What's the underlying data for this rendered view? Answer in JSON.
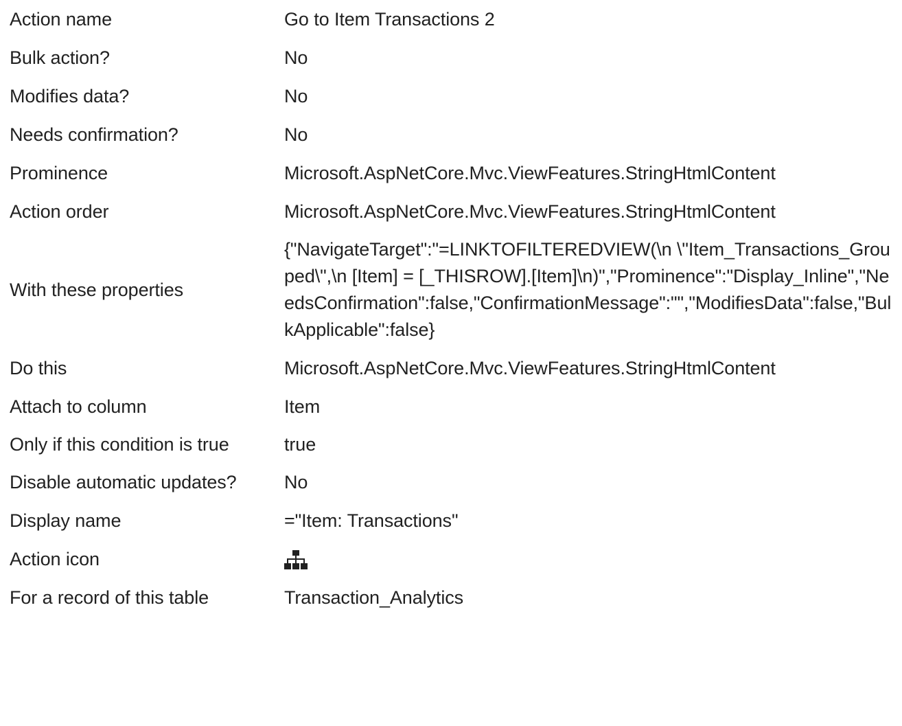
{
  "rows": [
    {
      "label": "Action name",
      "value": "Go to Item Transactions 2"
    },
    {
      "label": "Bulk action?",
      "value": "No"
    },
    {
      "label": "Modifies data?",
      "value": "No"
    },
    {
      "label": "Needs confirmation?",
      "value": "No"
    },
    {
      "label": "Prominence",
      "value": "Microsoft.AspNetCore.Mvc.ViewFeatures.StringHtmlContent"
    },
    {
      "label": "Action order",
      "value": "Microsoft.AspNetCore.Mvc.ViewFeatures.StringHtmlContent"
    },
    {
      "label": "With these properties",
      "value": "{\"NavigateTarget\":\"=LINKTOFILTEREDVIEW(\\n \\\"Item_Transactions_Grouped\\\",\\n [Item] = [_THISROW].[Item]\\n)\",\"Prominence\":\"Display_Inline\",\"NeedsConfirmation\":false,\"ConfirmationMessage\":\"\",\"ModifiesData\":false,\"BulkApplicable\":false}"
    },
    {
      "label": "Do this",
      "value": "Microsoft.AspNetCore.Mvc.ViewFeatures.StringHtmlContent"
    },
    {
      "label": "Attach to column",
      "value": "Item"
    },
    {
      "label": "Only if this condition is true",
      "value": "true"
    },
    {
      "label": "Disable automatic updates?",
      "value": "No"
    },
    {
      "label": "Display name",
      "value": "=\"Item: Transactions\""
    },
    {
      "label": "Action icon",
      "icon": "sitemap-icon"
    },
    {
      "label": "For a record of this table",
      "value": "Transaction_Analytics"
    }
  ]
}
